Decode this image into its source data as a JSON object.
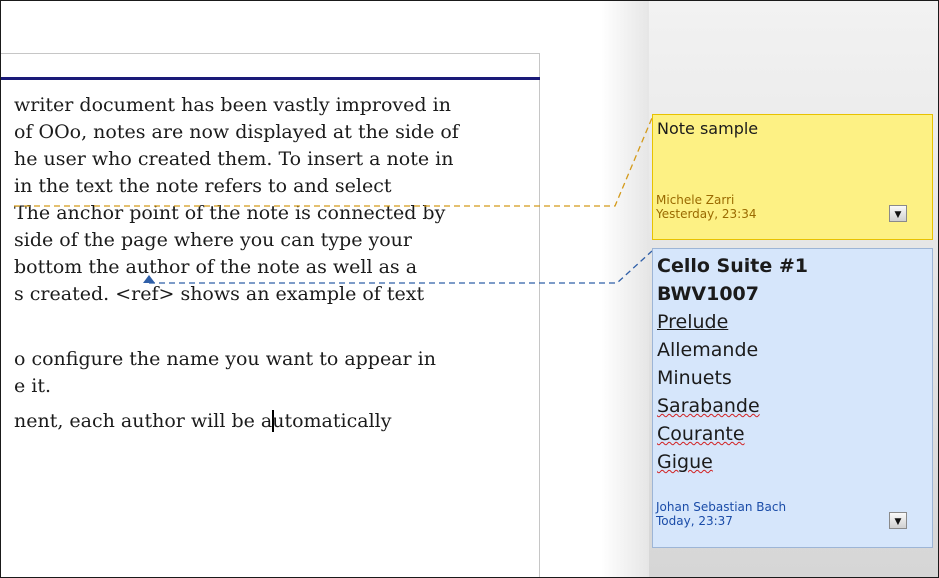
{
  "document": {
    "lines": [
      "writer document has been vastly improved in",
      "of OOo, notes are now displayed at the side of",
      "he user who created them. To insert a note in",
      " in the text the note refers to and select",
      "The anchor point of the note is connected by",
      "side of the page where you can type your",
      "bottom the author of the note as well as a",
      "s created. <ref> shows an example of text",
      "o configure the name you want to appear in",
      "e it.",
      "nent, each author will be a",
      "utomatically"
    ]
  },
  "notes": [
    {
      "color": "#fdf184",
      "text": "Note sample",
      "author": "Michele Zarri",
      "date": "Yesterday, 23:34",
      "menu_icon": "dropdown-arrow"
    },
    {
      "color": "#d6e6fb",
      "title_line1": "Cello Suite #1",
      "title_line2": "BWV1007",
      "items": [
        "Prelude",
        "Allemande",
        "Minuets",
        "Sarabande",
        "Courante",
        "Gigue"
      ],
      "author": "Johan Sebastian Bach",
      "date": "Today, 23:37",
      "menu_icon": "dropdown-arrow"
    }
  ],
  "anchor_colors": {
    "yellow_note": "#d49a1a",
    "blue_note": "#2f5fa8"
  }
}
